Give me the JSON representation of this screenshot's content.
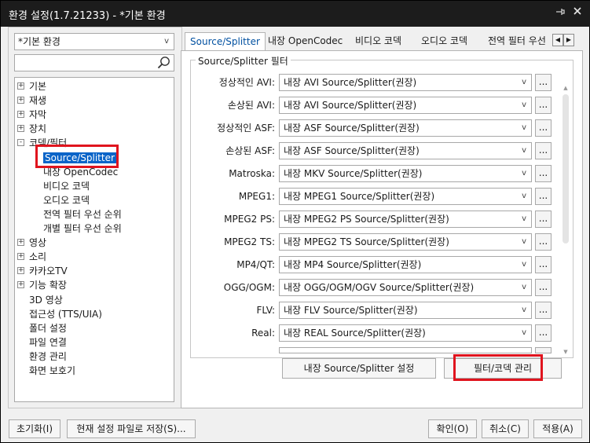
{
  "window": {
    "title": "환경 설정(1.7.21233) - *기본 환경",
    "pin_icon": "pin-icon",
    "close_icon": "close-icon"
  },
  "left": {
    "profile_value": "*기본 환경",
    "search_placeholder": "",
    "tree": [
      {
        "label": "기본",
        "expander": "+"
      },
      {
        "label": "재생",
        "expander": "+"
      },
      {
        "label": "자막",
        "expander": "+"
      },
      {
        "label": "장치",
        "expander": "+"
      },
      {
        "label": "코덱/필터",
        "expander": "-"
      },
      {
        "label": "Source/Splitter",
        "expander": ""
      },
      {
        "label": "내장 OpenCodec",
        "expander": ""
      },
      {
        "label": "비디오 코덱",
        "expander": ""
      },
      {
        "label": "오디오 코덱",
        "expander": ""
      },
      {
        "label": "전역 필터 우선 순위",
        "expander": ""
      },
      {
        "label": "개별 필터 우선 순위",
        "expander": ""
      },
      {
        "label": "영상",
        "expander": "+"
      },
      {
        "label": "소리",
        "expander": "+"
      },
      {
        "label": "카카오TV",
        "expander": "+"
      },
      {
        "label": "기능 확장",
        "expander": "+"
      },
      {
        "label": "3D 영상",
        "expander": ""
      },
      {
        "label": "접근성 (TTS/UIA)",
        "expander": ""
      },
      {
        "label": "폴더 설정",
        "expander": ""
      },
      {
        "label": "파일 연결",
        "expander": ""
      },
      {
        "label": "환경 관리",
        "expander": ""
      },
      {
        "label": "화면 보호기",
        "expander": ""
      }
    ]
  },
  "tabs": [
    "Source/Splitter",
    "내장 OpenCodec",
    "비디오 코덱",
    "오디오 코덱",
    "전역 필터 우선"
  ],
  "group": {
    "title": "Source/Splitter 필터",
    "more_label": "...",
    "rows": [
      {
        "label": "정상적인 AVI:",
        "value": "내장 AVI Source/Splitter(권장)"
      },
      {
        "label": "손상된 AVI:",
        "value": "내장 AVI Source/Splitter(권장)"
      },
      {
        "label": "정상적인 ASF:",
        "value": "내장 ASF Source/Splitter(권장)"
      },
      {
        "label": "손상된 ASF:",
        "value": "내장 ASF Source/Splitter(권장)"
      },
      {
        "label": "Matroska:",
        "value": "내장 MKV Source/Splitter(권장)"
      },
      {
        "label": "MPEG1:",
        "value": "내장 MPEG1 Source/Splitter(권장)"
      },
      {
        "label": "MPEG2 PS:",
        "value": "내장 MPEG2 PS Source/Splitter(권장)"
      },
      {
        "label": "MPEG2 TS:",
        "value": "내장 MPEG2 TS Source/Splitter(권장)"
      },
      {
        "label": "MP4/QT:",
        "value": "내장 MP4 Source/Splitter(권장)"
      },
      {
        "label": "OGG/OGM:",
        "value": "내장 OGG/OGM/OGV Source/Splitter(권장)"
      },
      {
        "label": "FLV:",
        "value": "내장 FLV Source/Splitter(권장)"
      },
      {
        "label": "Real:",
        "value": "내장 REAL Source/Splitter(권장)"
      }
    ]
  },
  "buttons": {
    "splitter_settings": "내장 Source/Splitter 설정",
    "filter_manage": "필터/코덱 관리",
    "reset": "초기화(I)",
    "save_current": "현재 설정 파일로 저장(S)...",
    "ok": "확인(O)",
    "cancel": "취소(C)",
    "apply": "적용(A)"
  },
  "colors": {
    "highlight": "#e0141e",
    "selection": "#0a64c8",
    "titlebar": "#1c1c1c"
  }
}
